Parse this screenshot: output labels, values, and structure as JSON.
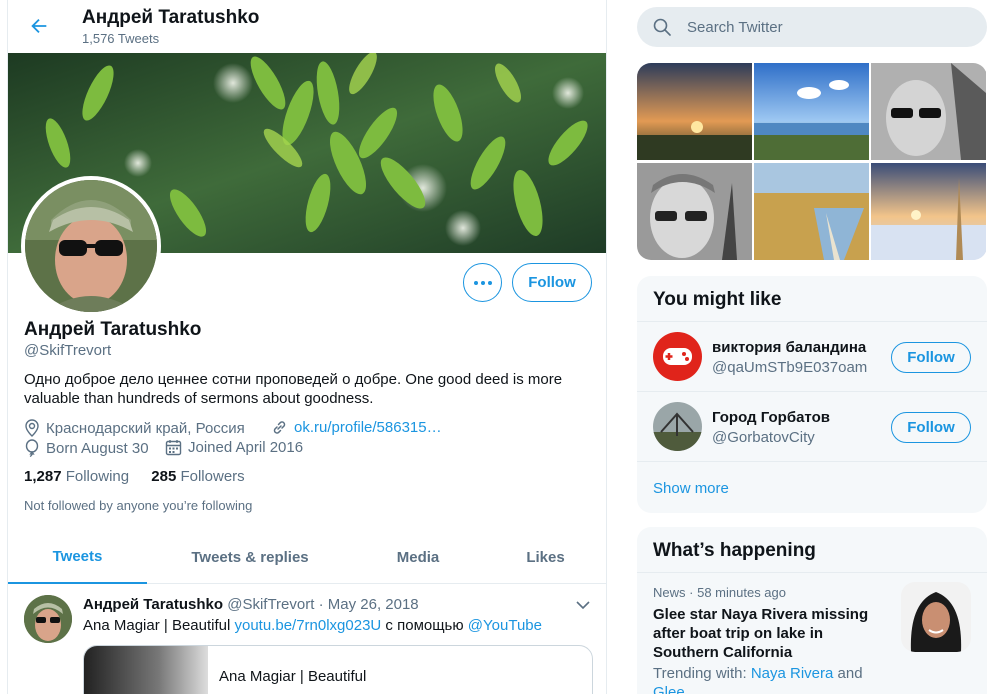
{
  "header": {
    "name": "Андрей Taratushko",
    "tweet_count": "1,576 Tweets"
  },
  "profile": {
    "name": "Андрей Taratushko",
    "handle": "@SkifTrevort",
    "bio": "Одно доброе дело ценнее сотни проповедей о добре.  One good deed is more valuable than hundreds of sermons about goodness.",
    "location": "Краснодарский край, Россия",
    "url": "ok.ru/profile/586315…",
    "birthday": "Born August 30",
    "joined": "Joined April 2016",
    "following_count": "1,287",
    "following_label": "Following",
    "followers_count": "285",
    "followers_label": "Followers",
    "not_followed": "Not followed by anyone you’re following",
    "follow_label": "Follow"
  },
  "tabs": [
    {
      "label": "Tweets",
      "active": true
    },
    {
      "label": "Tweets & replies",
      "active": false
    },
    {
      "label": "Media",
      "active": false
    },
    {
      "label": "Likes",
      "active": false
    }
  ],
  "tweet": {
    "name": "Андрей Taratushko",
    "handle": "@SkifTrevort",
    "dot": "·",
    "date": "May 26, 2018",
    "text_prefix": "Ana Magiar | Beautiful ",
    "link": "youtu.be/7rn0lxg023U",
    "text_middle": " с помощью ",
    "mention": "@YouTube",
    "card_title": "Ana Magiar | Beautiful"
  },
  "search": {
    "placeholder": "Search Twitter",
    "icon": "search-icon"
  },
  "who_to_follow": {
    "title": "You might like",
    "users": [
      {
        "name": "виктория баландина",
        "handle": "@qaUmSTb9E037oam",
        "follow": "Follow"
      },
      {
        "name": "Город Горбатов",
        "handle": "@GorbatovCity",
        "follow": "Follow"
      }
    ],
    "show_more": "Show more"
  },
  "trends": {
    "title": "What’s happening",
    "category": "News",
    "dot": "·",
    "time": "58 minutes ago",
    "headline": "Glee star Naya Rivera missing after boat trip on lake in Southern California",
    "trending_prefix": "Trending with: ",
    "trending_link": "Naya Rivera",
    "trending_and": " and",
    "trending_link2": "Glee"
  },
  "colors": {
    "accent": "#1b95e0",
    "muted": "#5b7083",
    "panel_bg": "#f5f8fa"
  }
}
